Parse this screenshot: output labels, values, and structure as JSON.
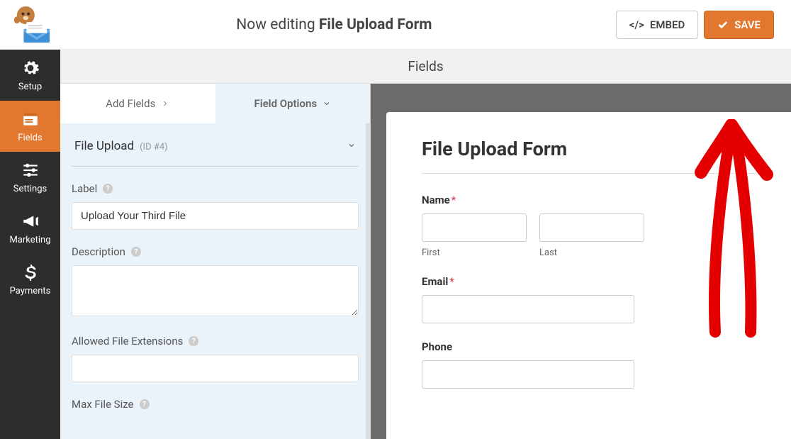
{
  "header": {
    "editing_prefix": "Now editing ",
    "form_name": "File Upload Form",
    "embed_label": "EMBED",
    "save_label": "SAVE"
  },
  "sidenav": {
    "setup": "Setup",
    "fields": "Fields",
    "settings": "Settings",
    "marketing": "Marketing",
    "payments": "Payments"
  },
  "panel": {
    "section_title": "Fields",
    "tab_add": "Add Fields",
    "tab_options": "Field Options",
    "field_type": "File Upload",
    "field_id": "(ID #4)",
    "labels": {
      "label": "Label",
      "description": "Description",
      "allowed_ext": "Allowed File Extensions",
      "max_size": "Max File Size"
    },
    "values": {
      "label": "Upload Your Third File",
      "description": "",
      "allowed_ext": ""
    }
  },
  "preview": {
    "title": "File Upload Form",
    "name_label": "Name",
    "first": "First",
    "last": "Last",
    "email_label": "Email",
    "phone_label": "Phone"
  }
}
